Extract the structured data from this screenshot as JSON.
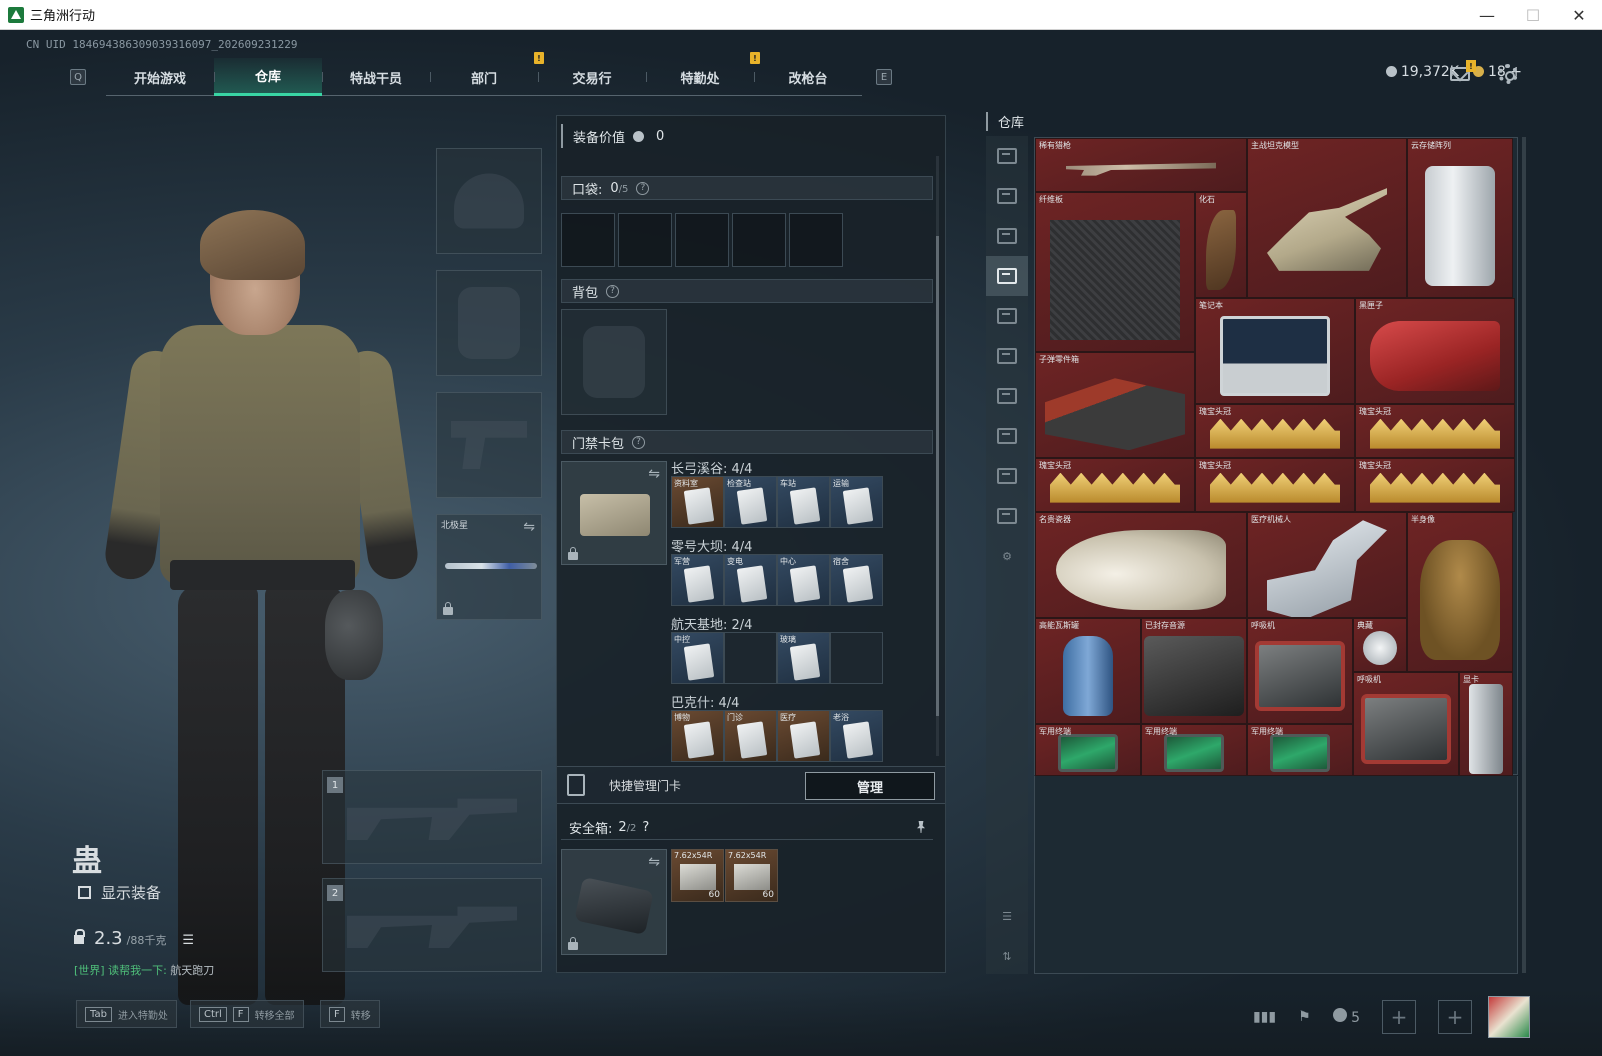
{
  "window": {
    "title": "三角洲行动",
    "controls": [
      "—",
      "☐",
      "✕"
    ]
  },
  "uid": "CN UID 1846943863090393160​97_202609231229",
  "nav": {
    "left_key": "Q",
    "right_key": "E",
    "tabs": [
      {
        "label": "开始游戏",
        "active": false,
        "notif": ""
      },
      {
        "label": "仓库",
        "active": true,
        "notif": ""
      },
      {
        "label": "特战干员",
        "active": false,
        "notif": ""
      },
      {
        "label": "部门",
        "active": false,
        "notif": "!"
      },
      {
        "label": "交易行",
        "active": false,
        "notif": ""
      },
      {
        "label": "特勤处",
        "active": false,
        "notif": "!"
      },
      {
        "label": "改枪台",
        "active": false,
        "notif": ""
      }
    ]
  },
  "currency": {
    "silver": "19,372K",
    "gold": "18",
    "gold_plus": "+"
  },
  "mail_badge": "!",
  "loadout": {
    "melee_label": "北极星",
    "slot1_num": "1",
    "slot2_num": "2"
  },
  "character": {
    "name": "蛊",
    "show_equip_label": "显示装备",
    "weight_value": "2.3",
    "weight_max": "/88千克",
    "list_icon": "☰"
  },
  "chat": {
    "channel": "[世界]",
    "name": "读帮我一下:",
    "message": "航天跑刀"
  },
  "equipment_panel": {
    "value_label": "装备价值",
    "value": "0",
    "pocket_label": "口袋:",
    "pocket_value": "0",
    "pocket_max": "/5",
    "backpack_label": "背包",
    "keycard_label": "门禁卡包",
    "help": "?",
    "keycard_groups": [
      {
        "title": "长弓溪谷: 4/4",
        "cards": [
          {
            "label": "资料室",
            "filled": true,
            "warm": true
          },
          {
            "label": "检查站",
            "filled": true,
            "warm": false
          },
          {
            "label": "车站",
            "filled": true,
            "warm": false
          },
          {
            "label": "运输",
            "filled": true,
            "warm": false
          }
        ]
      },
      {
        "title": "零号大坝: 4/4",
        "cards": [
          {
            "label": "军营",
            "filled": true,
            "warm": false
          },
          {
            "label": "变电",
            "filled": true,
            "warm": false
          },
          {
            "label": "中心",
            "filled": true,
            "warm": false
          },
          {
            "label": "宿舍",
            "filled": true,
            "warm": false
          }
        ]
      },
      {
        "title": "航天基地: 2/4",
        "cards": [
          {
            "label": "中控",
            "filled": true,
            "warm": false
          },
          {
            "label": "",
            "filled": false,
            "warm": false
          },
          {
            "label": "玻璃",
            "filled": true,
            "warm": false
          },
          {
            "label": "",
            "filled": false,
            "warm": false
          }
        ]
      },
      {
        "title": "巴克什: 4/4",
        "cards": [
          {
            "label": "博物",
            "filled": true,
            "warm": true
          },
          {
            "label": "门诊",
            "filled": true,
            "warm": true
          },
          {
            "label": "医疗",
            "filled": true,
            "warm": true
          },
          {
            "label": "老浴",
            "filled": true,
            "warm": false
          }
        ]
      }
    ],
    "quick_manage_label": "快捷管理门卡",
    "manage_button": "管理",
    "safe_label": "安全箱:",
    "safe_value": "2",
    "safe_max": "/2",
    "ammo": [
      {
        "label": "7.62x54R",
        "count": "60"
      },
      {
        "label": "7.62x54R",
        "count": "60"
      }
    ]
  },
  "warehouse": {
    "title": "仓库",
    "items": [
      {
        "label": "稀有猎枪",
        "pic": "p-gun"
      },
      {
        "label": "主战坦克模型",
        "pic": "p-tank"
      },
      {
        "label": "云存储阵列",
        "pic": "p-server"
      },
      {
        "label": "纤维板",
        "pic": "p-carbon"
      },
      {
        "label": "化石",
        "pic": "p-fossil"
      },
      {
        "label": "笔记本",
        "pic": "p-laptop"
      },
      {
        "label": "黑匣子",
        "pic": "p-blackbox"
      },
      {
        "label": "子弹零件箱",
        "pic": "p-bullets"
      },
      {
        "label": "瑰宝头冠",
        "pic": "p-crown"
      },
      {
        "label": "瑰宝头冠",
        "pic": "p-crown"
      },
      {
        "label": "瑰宝头冠",
        "pic": "p-crown"
      },
      {
        "label": "瑰宝头冠",
        "pic": "p-crown"
      },
      {
        "label": "瑰宝头冠",
        "pic": "p-crown"
      },
      {
        "label": "名贵瓷器",
        "pic": "p-vase"
      },
      {
        "label": "医疗机械人",
        "pic": "p-robotarm"
      },
      {
        "label": "半身像",
        "pic": "p-bust"
      },
      {
        "label": "高能瓦斯罐",
        "pic": "p-gascan"
      },
      {
        "label": "已封存音源",
        "pic": "p-recorder"
      },
      {
        "label": "呼吸机",
        "pic": "p-monitor"
      },
      {
        "label": "典藏",
        "pic": "p-coin"
      },
      {
        "label": "呼吸机",
        "pic": "p-monitor"
      },
      {
        "label": "显卡",
        "pic": "p-gpu"
      },
      {
        "label": "军用终端",
        "pic": "p-tablet"
      },
      {
        "label": "军用终端",
        "pic": "p-tablet"
      },
      {
        "label": "军用终端",
        "pic": "p-tablet"
      }
    ]
  },
  "hints": [
    {
      "key": "Tab",
      "key2": "",
      "label": "进入特勤处"
    },
    {
      "key": "Ctrl",
      "key2": "F",
      "label": "转移全部"
    },
    {
      "key": "F",
      "key2": "",
      "label": "转移"
    }
  ],
  "bottom": {
    "friends_count": "5"
  }
}
